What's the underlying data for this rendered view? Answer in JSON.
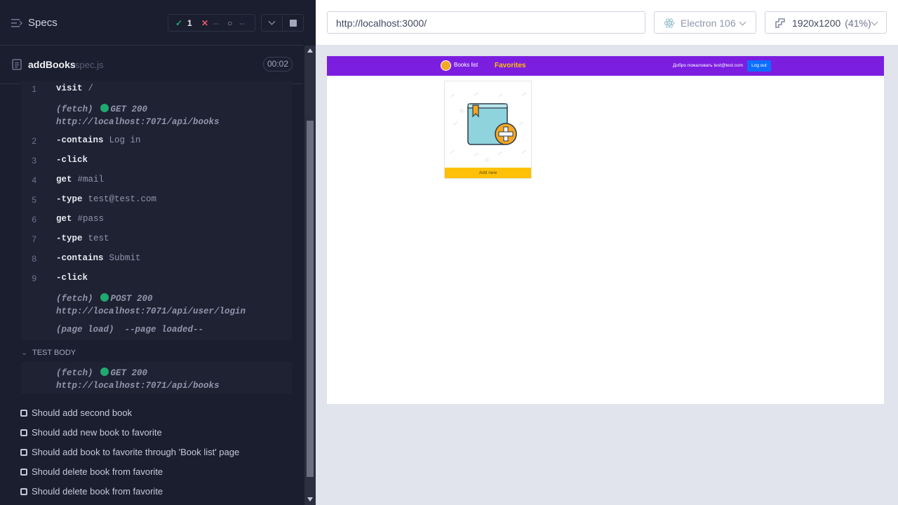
{
  "runner": {
    "specs_label": "Specs",
    "stats": {
      "passed": "1",
      "failed": "--",
      "pending": "--"
    },
    "spec": {
      "name": "addBooks",
      "ext": "spec.js",
      "duration": "00:02"
    },
    "commands": [
      {
        "line": "1",
        "name": "visit",
        "arg": "/",
        "dash": false
      },
      {
        "log": "(fetch)",
        "status": "GET 200",
        "url": "http://localhost:7071/api/books"
      },
      {
        "line": "2",
        "name": "contains",
        "arg": "Log in",
        "dash": true
      },
      {
        "line": "3",
        "name": "click",
        "arg": "",
        "dash": true
      },
      {
        "line": "4",
        "name": "get",
        "arg": "#mail",
        "dash": false
      },
      {
        "line": "5",
        "name": "type",
        "arg": "test@test.com",
        "dash": true
      },
      {
        "line": "6",
        "name": "get",
        "arg": "#pass",
        "dash": false
      },
      {
        "line": "7",
        "name": "type",
        "arg": "test",
        "dash": true
      },
      {
        "line": "8",
        "name": "contains",
        "arg": "Submit",
        "dash": true
      },
      {
        "line": "9",
        "name": "click",
        "arg": "",
        "dash": true
      },
      {
        "log": "(fetch)",
        "status": "POST 200",
        "url": "http://localhost:7071/api/user/login"
      },
      {
        "log": "(page load)",
        "status": "--page loaded--"
      }
    ],
    "test_body_label": "TEST BODY",
    "test_body": {
      "log": "(fetch)",
      "status": "GET 200",
      "url": "http://localhost:7071/api/books"
    },
    "tests": [
      "Should add second book",
      "Should add new book to favorite",
      "Should add book to favorite through 'Book list' page",
      "Should delete book from favorite",
      "Should delete book from favorite"
    ]
  },
  "browser": {
    "url": "http://localhost:3000/",
    "browser_name": "Electron 106",
    "viewport": "1920x1200",
    "scale": "(41%)"
  },
  "app": {
    "nav_books": "Books list",
    "nav_favorites": "Favorites",
    "welcome": "Добро пожаловать test@test.com",
    "logout": "Log out",
    "add_new": "Add new"
  },
  "colors": {
    "runner_bg": "#1b1e2e",
    "pass_green": "#1fa971",
    "app_nav_purple": "#7c1ee0",
    "add_button_yellow": "#ffc107"
  }
}
